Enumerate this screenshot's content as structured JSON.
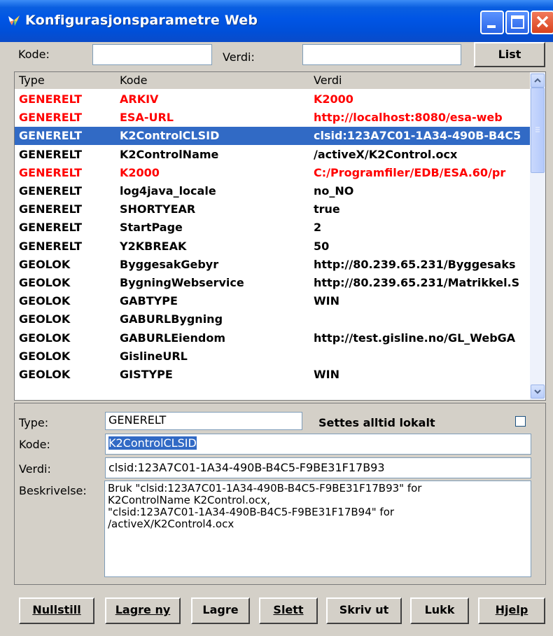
{
  "window": {
    "title": "Konfigurasjonsparametre Web"
  },
  "filter": {
    "kode_label": "Kode:",
    "kode_value": "",
    "verdi_label": "Verdi:",
    "verdi_value": "",
    "list_button": "List"
  },
  "grid": {
    "columns": [
      "Type",
      "Kode",
      "Verdi"
    ],
    "rows": [
      {
        "type": "GENERELT",
        "kode": "ARKIV",
        "verdi": "K2000",
        "style": "red"
      },
      {
        "type": "GENERELT",
        "kode": "ESA-URL",
        "verdi": "http://localhost:8080/esa-web",
        "style": "red"
      },
      {
        "type": "GENERELT",
        "kode": "K2ControlCLSID",
        "verdi": "clsid:123A7C01-1A34-490B-B4C5",
        "style": "selected"
      },
      {
        "type": "GENERELT",
        "kode": "K2ControlName",
        "verdi": "/activeX/K2Control.ocx",
        "style": "black"
      },
      {
        "type": "GENERELT",
        "kode": "K2000",
        "verdi": "C:/Programfiler/EDB/ESA.60/pr",
        "style": "red"
      },
      {
        "type": "GENERELT",
        "kode": "log4java_locale",
        "verdi": "no_NO",
        "style": "black"
      },
      {
        "type": "GENERELT",
        "kode": "SHORTYEAR",
        "verdi": "true",
        "style": "black"
      },
      {
        "type": "GENERELT",
        "kode": "StartPage",
        "verdi": "2",
        "style": "black"
      },
      {
        "type": "GENERELT",
        "kode": "Y2KBREAK",
        "verdi": "50",
        "style": "black"
      },
      {
        "type": "GEOLOK",
        "kode": "ByggesakGebyr",
        "verdi": "http://80.239.65.231/Byggesaks",
        "style": "black"
      },
      {
        "type": "GEOLOK",
        "kode": "BygningWebservice",
        "verdi": "http://80.239.65.231/Matrikkel.S",
        "style": "black"
      },
      {
        "type": "GEOLOK",
        "kode": "GABTYPE",
        "verdi": "WIN",
        "style": "black"
      },
      {
        "type": "GEOLOK",
        "kode": "GABURLBygning",
        "verdi": "",
        "style": "black"
      },
      {
        "type": "GEOLOK",
        "kode": "GABURLEiendom",
        "verdi": "http://test.gisline.no/GL_WebGA",
        "style": "black"
      },
      {
        "type": "GEOLOK",
        "kode": "GislineURL",
        "verdi": "",
        "style": "black"
      },
      {
        "type": "GEOLOK",
        "kode": "GISTYPE",
        "verdi": "WIN",
        "style": "black"
      }
    ],
    "colors": {
      "red": "#ff0000",
      "selected_bg": "#316ac5"
    }
  },
  "detail": {
    "type_label": "Type:",
    "type_value": "GENERELT",
    "lokalt_label": "Settes alltid lokalt",
    "lokalt_checked": false,
    "kode_label": "Kode:",
    "kode_value": "K2ControlCLSID",
    "verdi_label": "Verdi:",
    "verdi_value": "clsid:123A7C01-1A34-490B-B4C5-F9BE31F17B93",
    "beskrivelse_label": "Beskrivelse:",
    "beskrivelse_lines": [
      "Bruk \"clsid:123A7C01-1A34-490B-B4C5-F9BE31F17B93\" for",
      "K2ControlName K2Control.ocx,",
      "\"clsid:123A7C01-1A34-490B-B4C5-F9BE31F17B94\" for",
      "/activeX/K2Control4.ocx"
    ]
  },
  "buttons": {
    "nullstill": "Nullstill",
    "lagre_ny": "Lagre ny",
    "lagre": "Lagre",
    "slett": "Slett",
    "skriv_ut": "Skriv ut",
    "lukk": "Lukk",
    "hjelp": "Hjelp"
  }
}
